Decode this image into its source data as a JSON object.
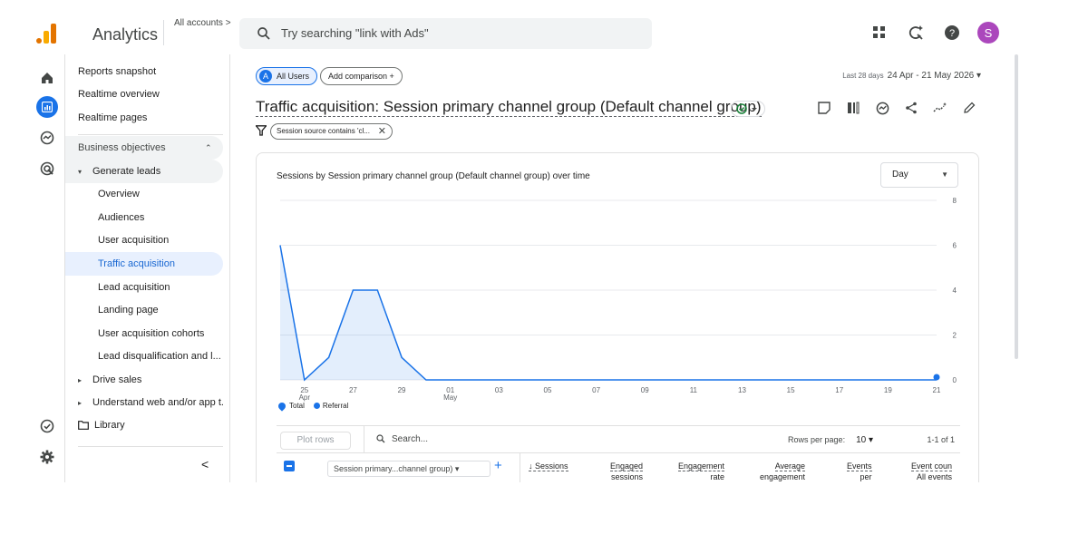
{
  "header": {
    "app_name": "Analytics",
    "accounts_label": "All accounts >",
    "search_placeholder": "Try searching \"link with Ads\"",
    "avatar_letter": "S",
    "logo_colors": [
      "#e37400",
      "#f9ab00"
    ]
  },
  "sidebar": {
    "items": [
      {
        "label": "Reports snapshot"
      },
      {
        "label": "Realtime overview"
      },
      {
        "label": "Realtime pages"
      }
    ],
    "section_label": "Business objectives",
    "group_label": "Generate leads",
    "sub_items": [
      {
        "label": "Overview"
      },
      {
        "label": "Audiences"
      },
      {
        "label": "User acquisition"
      },
      {
        "label": "Traffic acquisition"
      },
      {
        "label": "Lead acquisition"
      },
      {
        "label": "Landing page"
      },
      {
        "label": "User acquisition cohorts"
      },
      {
        "label": "Lead disqualification and l..."
      }
    ],
    "collapsed_groups": [
      {
        "label": "Drive sales"
      },
      {
        "label": "Understand web and/or app t..."
      }
    ],
    "library_label": "Library",
    "collapse_glyph": "<"
  },
  "toolbar": {
    "segment_badge": "A",
    "segment_label": "All Users",
    "add_comparison_label": "Add comparison +",
    "date_prefix": "Last 28 days",
    "date_range": "24 Apr - 21 May 2026 ▾"
  },
  "report": {
    "title": "Traffic acquisition: Session primary channel group (Default channel group)",
    "filter_label": "Session source contains 'cl...",
    "filter_close": "✕"
  },
  "chart": {
    "title": "Sessions by Session primary channel group (Default channel group) over time",
    "granularity": "Day",
    "legend": [
      {
        "name": "Total"
      },
      {
        "name": "Referral"
      }
    ],
    "accent_color": "#1a73e8"
  },
  "chart_data": {
    "type": "area",
    "x_tick_labels": [
      "25",
      "27",
      "29",
      "01",
      "03",
      "05",
      "07",
      "09",
      "11",
      "13",
      "15",
      "17",
      "19",
      "21"
    ],
    "x_sub_labels": [
      "Apr",
      "",
      "",
      "May",
      "",
      "",
      "",
      "",
      "",
      "",
      "",
      "",
      "",
      ""
    ],
    "y_ticks": [
      0,
      2,
      4,
      6,
      8
    ],
    "ylim": [
      0,
      8
    ],
    "grid": true,
    "legend_position": "bottom-left",
    "x": [
      "24 Apr",
      "25 Apr",
      "26 Apr",
      "27 Apr",
      "28 Apr",
      "29 Apr",
      "30 Apr",
      "01 May",
      "02 May",
      "03 May",
      "04 May",
      "05 May",
      "06 May",
      "07 May",
      "08 May",
      "09 May",
      "10 May",
      "11 May",
      "12 May",
      "13 May",
      "14 May",
      "15 May",
      "16 May",
      "17 May",
      "18 May",
      "19 May",
      "20 May",
      "21 May"
    ],
    "series": [
      {
        "name": "Total",
        "values": [
          6,
          0,
          1,
          4,
          4,
          1,
          0,
          0,
          0,
          0,
          0,
          0,
          0,
          0,
          0,
          0,
          0,
          0,
          0,
          0,
          0,
          0,
          0,
          0,
          0,
          0,
          0,
          0
        ]
      }
    ]
  },
  "table": {
    "plot_rows_label": "Plot rows",
    "search_placeholder": "Search...",
    "rows_per_page_label": "Rows per page:",
    "rows_per_page_value": "10 ▾",
    "pagination": "1-1 of 1",
    "dimension_label": "Session primary...channel group) ▾",
    "add_dimension": "+",
    "columns": [
      {
        "line1": "↓ Sessions",
        "line2": ""
      },
      {
        "line1": "Engaged",
        "line2": "sessions"
      },
      {
        "line1": "Engagement",
        "line2": "rate"
      },
      {
        "line1": "Average",
        "line2": "engagement"
      },
      {
        "line1": "Events",
        "line2": "per"
      },
      {
        "line1": "Event coun",
        "line2": "All events"
      }
    ]
  }
}
